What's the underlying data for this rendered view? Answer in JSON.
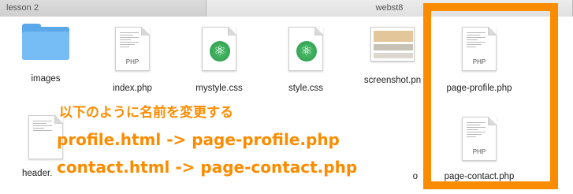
{
  "tabs": [
    {
      "label": "lesson 2"
    },
    {
      "label": "webst8"
    }
  ],
  "files": [
    {
      "name": "images",
      "type": "folder"
    },
    {
      "name": "index.php",
      "type": "php",
      "tag": "PHP"
    },
    {
      "name": "mystyle.css",
      "type": "css"
    },
    {
      "name": "style.css",
      "type": "css"
    },
    {
      "name": "screenshot.pn",
      "type": "image"
    },
    {
      "name": "page-profile.php",
      "type": "php",
      "tag": "PHP"
    },
    {
      "name": "header.",
      "type": "php"
    },
    {
      "name": "page-contact.php",
      "type": "php",
      "tag": "PHP"
    },
    {
      "name": "o",
      "type": "partial"
    }
  ],
  "annotation": {
    "line1": "以下のように名前を変更する",
    "line2": "profile.html -> page-profile.php",
    "line3": "contact.html -> page-contact.php",
    "color": "#fb8c00"
  }
}
